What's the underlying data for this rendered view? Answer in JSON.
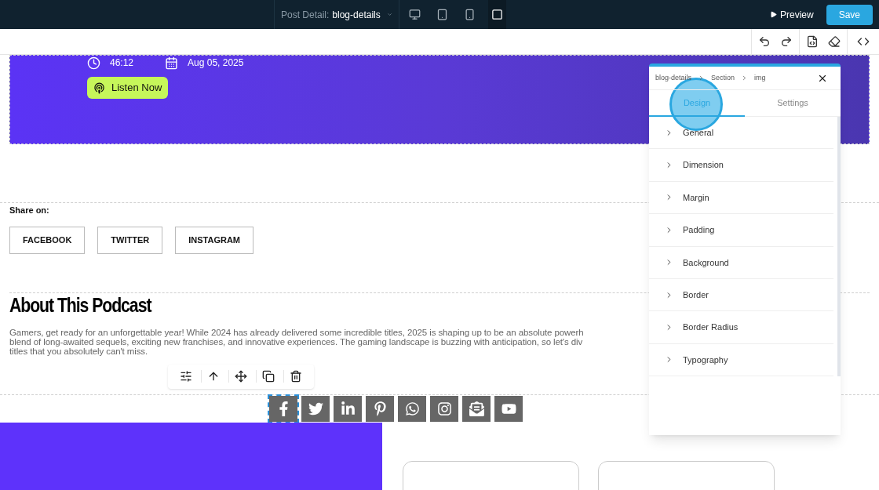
{
  "top_bar": {
    "page_label": "Post Detail:",
    "page_name": "blog-details",
    "devices": [
      {
        "kind": "desktop",
        "selected": false
      },
      {
        "kind": "tablet",
        "selected": false
      },
      {
        "kind": "phone",
        "selected": false
      },
      {
        "kind": "square",
        "selected": true
      }
    ],
    "preview": "Preview",
    "save": "Save"
  },
  "hero": {
    "duration": "46:12",
    "date": "Aug 05, 2025",
    "listen": "Listen Now"
  },
  "share": {
    "label": "Share on:",
    "buttons": [
      "FACEBOOK",
      "TWITTER",
      "INSTAGRAM"
    ]
  },
  "about": {
    "title": "About This Podcast",
    "lines": [
      "Gamers, get ready for an unforgettable year! While 2024 has already delivered some incredible titles, 2025 is shaping up to be an absolute powerh",
      "blend of long-awaited sequels, exciting new franchises, and innovative experiences. The gaming landscape is buzzing with anticipation, so let's div",
      "titles that you absolutely can't miss."
    ]
  },
  "social_icons": [
    {
      "kind": "facebook",
      "selected": true
    },
    {
      "kind": "twitter",
      "selected": false
    },
    {
      "kind": "linkedin",
      "selected": false
    },
    {
      "kind": "pinterest",
      "selected": false
    },
    {
      "kind": "whatsapp",
      "selected": false
    },
    {
      "kind": "instagram",
      "selected": false
    },
    {
      "kind": "mail",
      "selected": false
    },
    {
      "kind": "youtube",
      "selected": false
    }
  ],
  "panel": {
    "breadcrumb": [
      "blog-details",
      "Section",
      "img"
    ],
    "tabs": [
      {
        "label": "Design",
        "selected": true
      },
      {
        "label": "Settings",
        "selected": false
      }
    ],
    "sections": [
      "General",
      "Dimension",
      "Margin",
      "Padding",
      "Background",
      "Border",
      "Border Radius",
      "Typography"
    ]
  }
}
